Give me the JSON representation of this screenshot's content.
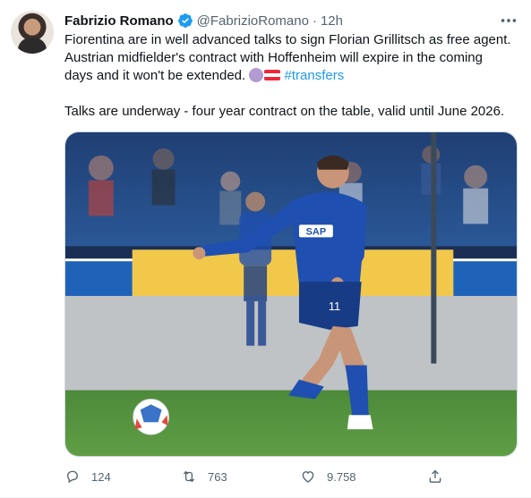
{
  "tweet": {
    "author_name": "Fabrizio Romano",
    "handle": "@FabrizioRomano",
    "separator": "·",
    "time": "12h",
    "line1": "Fiorentina are in well advanced talks to sign Florian Grillitsch as free agent.",
    "line2": "Austrian midfielder's contract with Hoffenheim will expire in the coming",
    "line3_prefix": "days and it won't be extended.",
    "hashtag": "#transfers",
    "line4": "Talks are underway - four year contract on the table, valid until June 2026.",
    "jersey_sponsor": "SAP",
    "jersey_number": "11"
  },
  "actions": {
    "reply_count": "124",
    "retweet_count": "763",
    "like_count": "9.758"
  },
  "icons": {
    "verified": "verified-badge-icon",
    "more": "more-options-icon",
    "reply": "reply-icon",
    "retweet": "retweet-icon",
    "like": "heart-icon",
    "share": "share-icon"
  },
  "colors": {
    "link": "#1d9bf0",
    "secondary": "#536471",
    "text": "#0f1419"
  }
}
